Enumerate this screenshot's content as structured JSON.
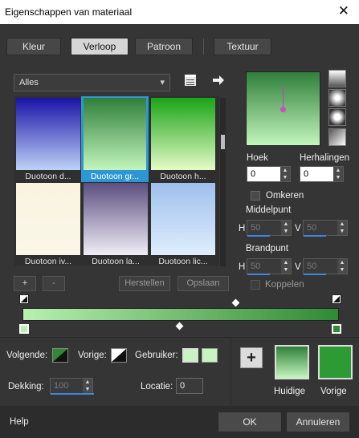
{
  "window": {
    "title": "Eigenschappen van materiaal",
    "close_glyph": "✕"
  },
  "tabs": [
    "Kleur",
    "Verloop",
    "Patroon",
    "Textuur"
  ],
  "dropdown": {
    "value": "Alles",
    "arrow": "▾"
  },
  "icons": {
    "book": "book-icon",
    "arrow": "arrow-right-icon",
    "shape_linear": "linear-gradient-icon",
    "shape_rect": "rectangular-gradient-icon",
    "shape_sunburst": "sunburst-gradient-icon",
    "shape_radial": "radial-gradient-icon"
  },
  "gradients": [
    {
      "label": "Duotoon d...",
      "top": "#1a12a6",
      "bottom": "#bcd1f7"
    },
    {
      "label": "Duotoon gr...",
      "top": "#2f7f3a",
      "bottom": "#c3f5bd"
    },
    {
      "label": "Duotoon h...",
      "top": "#1aa416",
      "bottom": "#e4fbc6"
    },
    {
      "label": "Duotoon iv...",
      "top": "#f9f3df",
      "bottom": "#fbf7e8"
    },
    {
      "label": "Duotoon la...",
      "top": "#5b4f80",
      "bottom": "#f1edf7"
    },
    {
      "label": "Duotoon lic...",
      "top": "#9ec0ed",
      "bottom": "#dfeefc"
    }
  ],
  "list_buttons": {
    "add": "+",
    "remove": "-",
    "reset": "Herstellen",
    "save": "Opslaan"
  },
  "angle": {
    "label": "Hoek",
    "value": "0"
  },
  "repeats": {
    "label": "Herhalingen",
    "value": "0"
  },
  "invert": {
    "label": "Omkeren"
  },
  "midpoint": {
    "label": "Middelpunt",
    "h_label": "H",
    "h_value": "50",
    "v_label": "V",
    "v_value": "50"
  },
  "focalpoint": {
    "label": "Brandpunt",
    "h_label": "H",
    "h_value": "50",
    "v_label": "V",
    "v_value": "50"
  },
  "link": {
    "label": "Koppelen"
  },
  "stops": {
    "left_color": "#b8f0b0",
    "right_color": "#2f8a34"
  },
  "bottom": {
    "next_label": "Volgende:",
    "prev_label": "Vorige:",
    "user_label": "Gebruiker:",
    "opacity_label": "Dekking:",
    "opacity_value": "100",
    "location_label": "Locatie:",
    "location_value": "0"
  },
  "swatches": {
    "current_label": "Huidige",
    "previous_label": "Vorige",
    "current_top": "#2f7f3a",
    "current_bottom": "#c3f5bd",
    "previous_color": "#2d9a34"
  },
  "footer": {
    "help": "Help",
    "ok": "OK",
    "cancel": "Annuleren"
  }
}
